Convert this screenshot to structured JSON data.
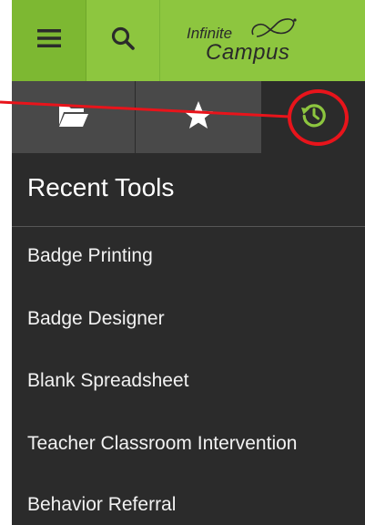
{
  "header": {
    "menu_icon": "hamburger-menu-icon",
    "search_icon": "search-icon",
    "logo": {
      "line1": "Infinite",
      "line2": "Campus"
    }
  },
  "tabs": [
    {
      "name": "files",
      "icon": "folder-open-icon"
    },
    {
      "name": "favorites",
      "icon": "star-icon"
    },
    {
      "name": "recent",
      "icon": "history-icon",
      "active": true
    }
  ],
  "recent": {
    "title": "Recent Tools",
    "items": [
      {
        "label": "Badge Printing"
      },
      {
        "label": "Badge Designer"
      },
      {
        "label": "Blank Spreadsheet"
      },
      {
        "label": "Teacher Classroom Intervention"
      },
      {
        "label": "Behavior Referral"
      }
    ]
  },
  "colors": {
    "brand_green": "#8dc63f",
    "panel_dark": "#2b2b2b",
    "annotation_red": "#e8141b"
  }
}
